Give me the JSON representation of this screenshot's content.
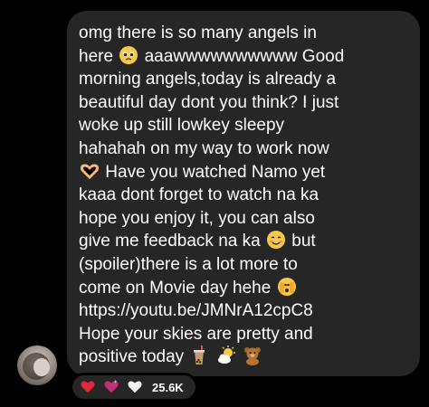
{
  "message": {
    "lines": [
      "omg there is so many angels in",
      "here",
      " aaawwwwwwwwww Good",
      "morning angels,today is already a",
      "beautiful day dont you think? I just",
      "woke up still lowkey sleepy",
      "hahahah on my way to work now",
      " Have you watched Namo yet",
      "kaaa dont forget to watch na ka",
      "hope you enjoy it, you can also",
      "give me feedback na ka",
      " but",
      "(spoiler)there is a lot more to",
      "come on Movie day hehe",
      "https://youtu.be/JMNrA12cpC8",
      "Hope your skies are pretty and",
      "positive today "
    ],
    "emojis": {
      "pleading": "pleading-face-emoji",
      "heart_hands": "heart-hands-emoji",
      "smiling_blush": "smiling-face-emoji",
      "peeking": "face-peeking-emoji",
      "bubble_tea": "bubble-tea-emoji",
      "sun_clouds": "sun-behind-cloud-emoji",
      "teddy_bear": "teddy-bear-emoji"
    }
  },
  "reactions": {
    "icons": [
      "red-heart-icon",
      "purple-sparkling-heart-icon",
      "white-heart-icon"
    ],
    "count": "25.6K"
  },
  "colors": {
    "background": "#000000",
    "bubble": "#262626",
    "text": "#ffffff"
  }
}
